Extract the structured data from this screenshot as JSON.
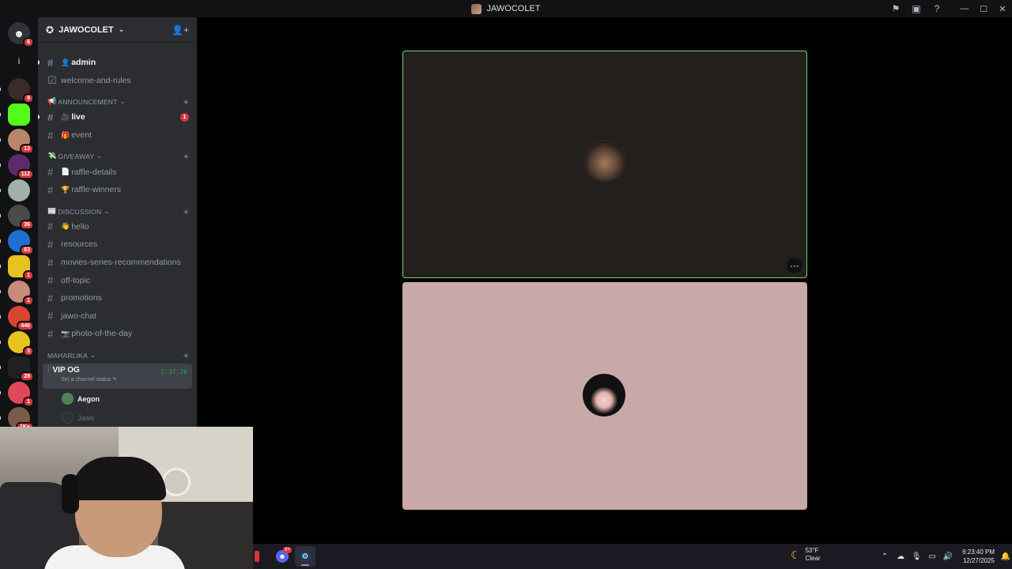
{
  "window": {
    "title": "JAWOCOLET",
    "controls": [
      "minimize",
      "maximize",
      "close"
    ]
  },
  "guild_bar": {
    "home_badge": "6",
    "servers": [
      {
        "name": "server-1",
        "badge": "9",
        "color": "#3a2a2a"
      },
      {
        "name": "server-kick",
        "badge": "",
        "color": "#53fc18"
      },
      {
        "name": "server-3",
        "badge": "13",
        "color": "#b8876a"
      },
      {
        "name": "server-4",
        "badge": "112",
        "color": "#5a2c6e"
      },
      {
        "name": "server-5",
        "badge": "",
        "color": "#9fb1a8"
      },
      {
        "name": "server-6",
        "badge": "36",
        "color": "#4a4a4a"
      },
      {
        "name": "server-7",
        "badge": "63",
        "color": "#1f6fd1"
      },
      {
        "name": "server-8",
        "badge": "1",
        "color": "#e8c21f"
      },
      {
        "name": "server-9",
        "badge": "1",
        "color": "#c98a7a"
      },
      {
        "name": "server-10",
        "badge": "446",
        "color": "#d9442e"
      },
      {
        "name": "server-11",
        "badge": "3",
        "color": "#e8c21f"
      },
      {
        "name": "server-12",
        "badge": "28",
        "color": "#202020"
      },
      {
        "name": "server-13",
        "badge": "1",
        "color": "#e0485a"
      },
      {
        "name": "server-14",
        "badge": "1K+",
        "color": "#7a5a4a"
      }
    ]
  },
  "sidebar": {
    "server_name": "JAWOCOLET",
    "channels_top": [
      {
        "icon": "#",
        "emoji": "👤",
        "label": "admin",
        "bold": true,
        "unread": true
      },
      {
        "icon": "☑",
        "emoji": "",
        "label": "welcome-and-rules",
        "bold": false,
        "unread": false
      }
    ],
    "categories": [
      {
        "label": "ANNOUNCEMENT",
        "emoji": "📢",
        "channels": [
          {
            "emoji": "🎥",
            "label": "live",
            "bold": true,
            "unread": true,
            "mention": "1"
          },
          {
            "emoji": "🎁",
            "label": "event",
            "bold": false,
            "unread": false,
            "mention": ""
          }
        ]
      },
      {
        "label": "GIVEAWAY",
        "emoji": "💸",
        "channels": [
          {
            "emoji": "📄",
            "label": "raffle-details",
            "bold": false,
            "unread": false,
            "mention": ""
          },
          {
            "emoji": "🏆",
            "label": "raffle-winners",
            "bold": false,
            "unread": false,
            "mention": ""
          }
        ]
      },
      {
        "label": "DISCUSSION",
        "emoji": "📰",
        "channels": [
          {
            "emoji": "👋",
            "label": "hello",
            "bold": false,
            "unread": false,
            "mention": ""
          },
          {
            "emoji": "",
            "label": "resources",
            "bold": false,
            "unread": false,
            "mention": ""
          },
          {
            "emoji": "",
            "label": "movies-series-recommendations",
            "bold": false,
            "unread": false,
            "mention": ""
          },
          {
            "emoji": "",
            "label": "off-topic",
            "bold": false,
            "unread": false,
            "mention": ""
          },
          {
            "emoji": "",
            "label": "promotions",
            "bold": false,
            "unread": false,
            "mention": ""
          },
          {
            "emoji": "",
            "label": "jawo-chat",
            "bold": false,
            "unread": false,
            "mention": ""
          },
          {
            "emoji": "📷",
            "label": "photo-of-the-day",
            "bold": false,
            "unread": false,
            "mention": ""
          }
        ]
      }
    ],
    "voice_category": "MAHARLIKA",
    "voice_channel": {
      "name": "VIP OG",
      "status": "Set a channel status",
      "timer": "2:37:26",
      "users": [
        "Aegon",
        "Jawo"
      ]
    }
  },
  "stage": {
    "tiles": [
      {
        "name": "participant-1",
        "speaking": true,
        "bg": "#231f1d"
      },
      {
        "name": "participant-2",
        "speaking": false,
        "bg": "#c9a8a8"
      }
    ],
    "more_label": "···"
  },
  "taskbar": {
    "discord_badge": "9+",
    "weather_temp": "53°F",
    "weather_desc": "Clear",
    "time": "6:23:40 PM",
    "date": "12/27/2025"
  }
}
